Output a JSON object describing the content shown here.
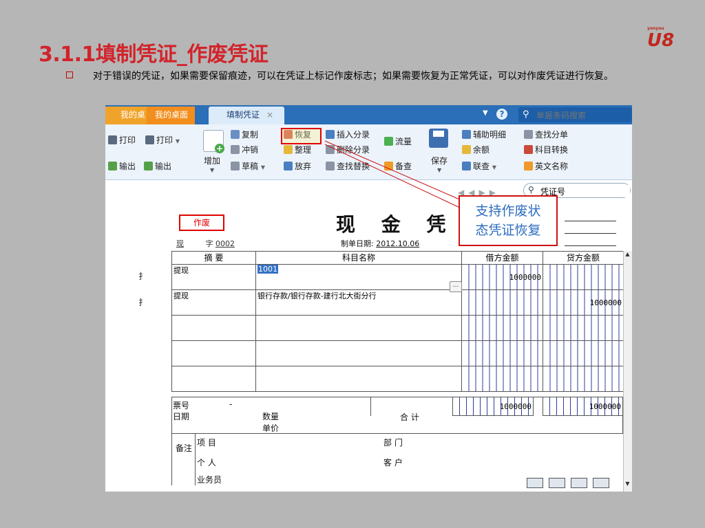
{
  "slide": {
    "title": "3.1.1填制凭证_作废凭证",
    "bullet": "对于错误的凭证，如果需要保留痕迹，可以在凭证上标记作废标志；如果需要恢复为正常凭证，可以对作废凭证进行恢复。",
    "logo_small": "yonyou",
    "logo": "U8"
  },
  "app": {
    "tabs": [
      {
        "label": "我的桌"
      },
      {
        "label": "我的桌面"
      },
      {
        "label": "填制凭证",
        "close": "×"
      }
    ],
    "search_placeholder": "单据条码搜索",
    "help": "?",
    "ribbon": {
      "print1": "打印",
      "print2": "打印",
      "export1": "输出",
      "export2": "输出",
      "add": "增加",
      "copy": "复制",
      "reverse": "冲销",
      "draft": "草稿",
      "restore": "恢复",
      "organize": "整理",
      "discard": "放弃",
      "insert_entry": "插入分录",
      "delete_entry": "删除分录",
      "find_replace": "查找替换",
      "cash_flow": "流量",
      "check": "备查",
      "save": "保存",
      "aux_detail": "辅助明细",
      "balance": "余额",
      "linked_query": "联查",
      "find_entry": "查找分单",
      "subject_convert": "科目转换",
      "english_name": "英文名称"
    },
    "voucher_search_value": "凭证号"
  },
  "voucher": {
    "void_stamp": "作废",
    "title": "现 金 凭 证",
    "type": "现",
    "zi": "字",
    "number": "0002",
    "date_label": "制单日期:",
    "date": "2012.10.06",
    "headers": {
      "summary": "摘 要",
      "subject": "科目名称",
      "debit": "借方金额",
      "credit": "贷方金额"
    },
    "rows": [
      {
        "summary": "提现",
        "subject": "1001",
        "debit": "1000000",
        "credit": ""
      },
      {
        "summary": "提现",
        "subject": "银行存款/银行存款-建行北大街分行",
        "debit": "",
        "credit": "1000000"
      }
    ],
    "footer": {
      "ticket_no": "票号",
      "dash": "-",
      "date": "日期",
      "qty": "数量",
      "price": "单价",
      "total": "合 计",
      "total_debit": "1000000",
      "total_credit": "1000000"
    },
    "remarks": {
      "label": "备注",
      "project": "项 目",
      "dept": "部 门",
      "person": "个 人",
      "customer": "客 户",
      "salesman": "业务员"
    }
  },
  "callout": {
    "line1": "支持作废状",
    "line2": "态凭证恢复"
  },
  "colors": {
    "title_red": "#d2232a",
    "tab_blue": "#2a6fb8",
    "callout_text": "#2d6cc0"
  }
}
